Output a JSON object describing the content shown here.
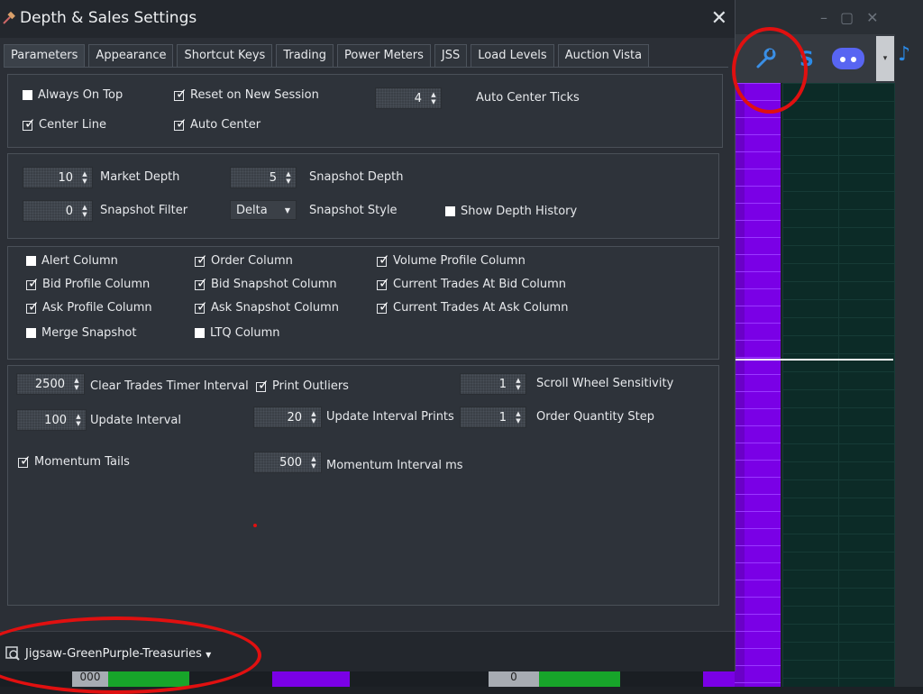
{
  "dialog": {
    "title": "Depth & Sales Settings",
    "close_glyph": "✕",
    "tabs": [
      "Parameters",
      "Appearance",
      "Shortcut Keys",
      "Trading",
      "Power Meters",
      "JSS",
      "Load Levels",
      "Auction Vista"
    ],
    "active_tab": "Parameters"
  },
  "group1": {
    "always_on_top": {
      "label": "Always On Top",
      "checked": false
    },
    "reset_on_new_session": {
      "label": "Reset on New Session",
      "checked": true
    },
    "center_line": {
      "label": "Center Line",
      "checked": true
    },
    "auto_center": {
      "label": "Auto Center",
      "checked": true
    },
    "auto_center_ticks": {
      "label": "Auto Center Ticks",
      "value": "4"
    }
  },
  "group2": {
    "market_depth": {
      "label": "Market Depth",
      "value": "10"
    },
    "snapshot_depth": {
      "label": "Snapshot Depth",
      "value": "5"
    },
    "snapshot_filter": {
      "label": "Snapshot Filter",
      "value": "0"
    },
    "snapshot_style": {
      "label": "Snapshot Style",
      "value": "Delta"
    },
    "show_depth_history": {
      "label": "Show Depth History",
      "checked": false
    }
  },
  "group3": {
    "alert_column": {
      "label": "Alert Column",
      "checked": false
    },
    "order_column": {
      "label": "Order Column",
      "checked": true
    },
    "volume_profile_column": {
      "label": "Volume Profile Column",
      "checked": true
    },
    "bid_profile_column": {
      "label": "Bid Profile Column",
      "checked": true
    },
    "bid_snapshot_column": {
      "label": "Bid Snapshot Column",
      "checked": true
    },
    "current_trades_at_bid_column": {
      "label": "Current Trades At Bid Column",
      "checked": true
    },
    "ask_profile_column": {
      "label": "Ask Profile Column",
      "checked": true
    },
    "ask_snapshot_column": {
      "label": "Ask Snapshot Column",
      "checked": true
    },
    "current_trades_at_ask_column": {
      "label": "Current Trades At Ask Column",
      "checked": true
    },
    "merge_snapshot": {
      "label": "Merge Snapshot",
      "checked": false
    },
    "ltq_column": {
      "label": "LTQ Column",
      "checked": false
    }
  },
  "group4": {
    "clear_trades_timer_interval": {
      "label": "Clear Trades Timer Interval",
      "value": "2500"
    },
    "print_outliers": {
      "label": "Print Outliers",
      "checked": true
    },
    "scroll_wheel_sensitivity": {
      "label": "Scroll Wheel Sensitivity",
      "value": "1"
    },
    "update_interval": {
      "label": "Update Interval",
      "value": "100"
    },
    "update_interval_prints": {
      "label": "Update Interval Prints",
      "value": "20"
    },
    "order_quantity_step": {
      "label": "Order Quantity Step",
      "value": "1"
    },
    "momentum_tails": {
      "label": "Momentum Tails",
      "checked": true
    },
    "momentum_interval_ms": {
      "label": "Momentum Interval ms",
      "value": "500"
    }
  },
  "footer": {
    "template_name": "Jigsaw-GreenPurple-Treasuries"
  },
  "background": {
    "bottom_value_left": "000",
    "bottom_value_mid": "0"
  },
  "colors": {
    "accent_purple": "#7a00e6",
    "annotation_red": "#e01010",
    "grid_teal": "#0c2b27",
    "trade_green": "#17a52a"
  }
}
